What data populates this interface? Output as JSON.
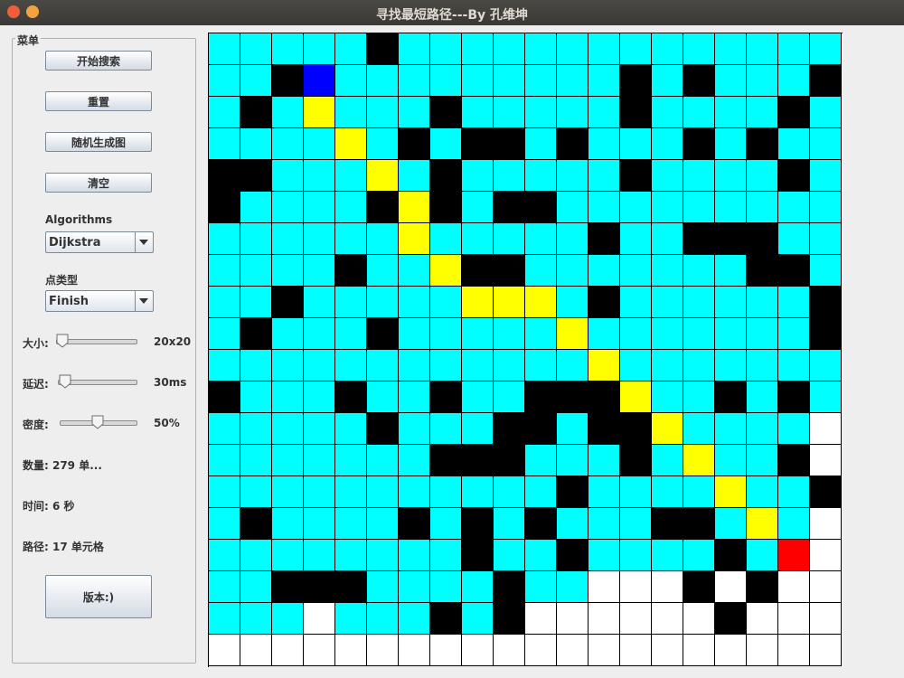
{
  "window": {
    "title": "寻找最短路径---By 孔维坤"
  },
  "menu": {
    "legend": "菜单",
    "buttons": [
      "开始搜索",
      "重置",
      "随机生成图",
      "清空"
    ],
    "algorithms_label": "Algorithms",
    "algorithm_selected": "Dijkstra",
    "point_type_label": "点类型",
    "point_type_selected": "Finish",
    "size_label": "大小:",
    "size_value": "20x20",
    "delay_label": "延迟:",
    "delay_value": "30ms",
    "density_label": "密度:",
    "density_value": "50%",
    "density_level": 0.5,
    "count_text": "数量: 279 单...",
    "time_text": "时间: 6 秒",
    "path_text": "路径: 17 单元格",
    "version_button": "版本:)"
  },
  "legend_colors": {
    "C": "#00ffff",
    "W": "#000000",
    "S": "#0000ff",
    "F": "#ff0000",
    "P": "#ffff00",
    "E": "#ffffff"
  },
  "grid": {
    "size": 20,
    "rows": [
      "CCCCCWCCCCCCCCCCCCCC",
      "CCWSCCCCCCCCCWCWCCCW",
      "CWCPCCCWCCCCCWCCCCWC",
      "CCCCPCWCWWCWCCCWCWCC",
      "WWCCCPCWCCCCCWCCCCWC",
      "WCCCCWPWCWWCCCCCCCCC",
      "CCCCCCPCCCCCWCCWWWCC",
      "CCCCWCCPWWCCCCCCCWWC",
      "CCWCCCCCPPPCWCCCCCCW",
      "CWCCCWCCCCCPCCCCCCCW",
      "CCCCCCCCCCCCPCCCCCCC",
      "WCCCWCCWCCWWWPCCWCWC",
      "CCCCCWCCCWWCWWPCCCCE",
      "CCCCCCCWWWCCCWCPCCWE",
      "CCCCCCCCCCCWCCCCPCCW",
      "CWCCCCWCWCWCCCWWCPCE",
      "CCCCCCCCWCCWCCCCWCFE",
      "CCWWWCCCCWCCEEEWEWEE",
      "CCCECCCWCWEEEEEEWEEE",
      "EEEEEEEEEEEEEEEEEEEE"
    ]
  }
}
